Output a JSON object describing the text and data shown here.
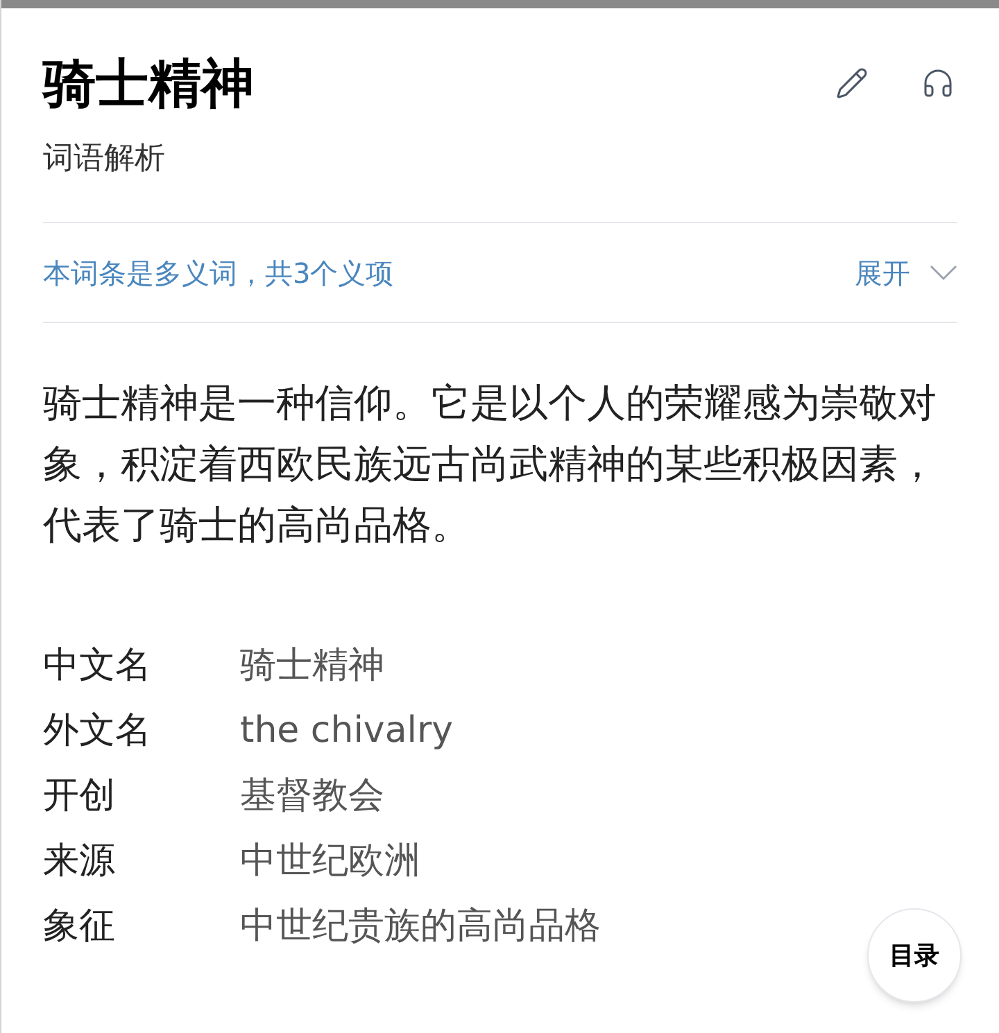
{
  "title": "骑士精神",
  "subtitle": "词语解析",
  "polysemy": {
    "text": "本词条是多义词，共3个义项",
    "toggle": "展开",
    "expanded": false
  },
  "summary": "骑士精神是一种信仰。它是以个人的荣耀感为崇敬对象，积淀着西欧民族远古尚武精神的某些积极因素，代表了骑士的高尚品格。",
  "basic_info": [
    {
      "label": "中文名",
      "value": "骑士精神"
    },
    {
      "label": "外文名",
      "value": "the chivalry"
    },
    {
      "label": "开创",
      "value": "基督教会"
    },
    {
      "label": "来源",
      "value": "中世纪欧洲"
    },
    {
      "label": "象征",
      "value": "中世纪贵族的高尚品格"
    }
  ],
  "toc_button": "目录"
}
